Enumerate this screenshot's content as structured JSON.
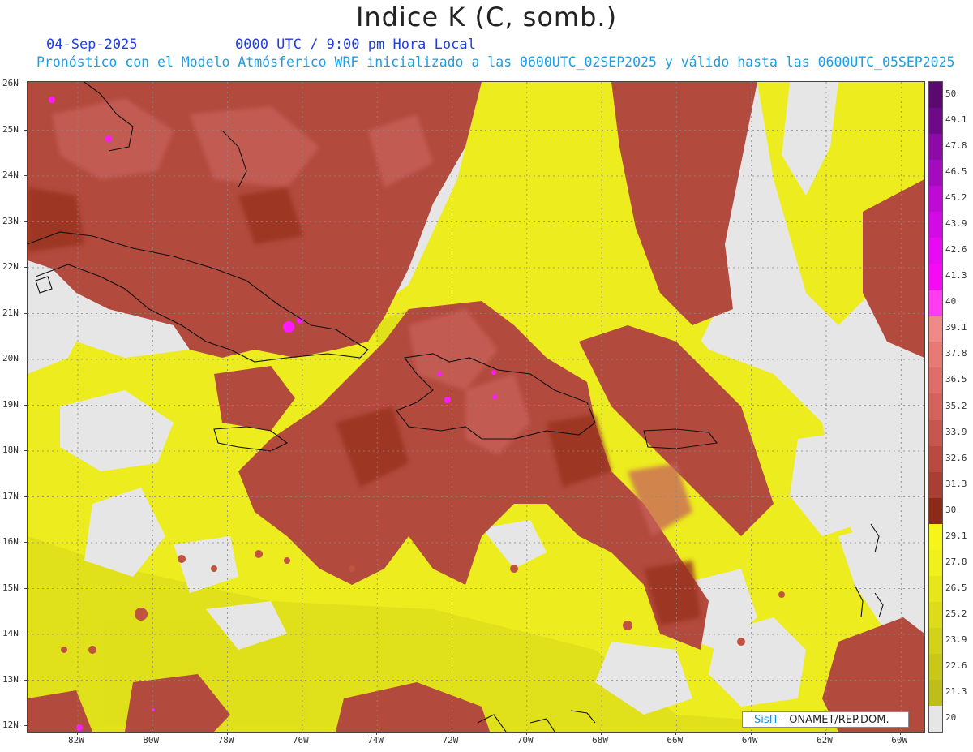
{
  "header": {
    "title": "Indice K (C, somb.)",
    "date": "04-Sep-2025",
    "time": "0000 UTC / 9:00 pm Hora Local",
    "description": "Pronóstico con el Modelo Atmósferico WRF inicializado a las 0600UTC_02SEP2025 y válido hasta las  0600UTC_05SEP2025"
  },
  "map": {
    "lat_labels": [
      "26N",
      "25N",
      "24N",
      "23N",
      "22N",
      "21N",
      "20N",
      "19N",
      "18N",
      "17N",
      "16N",
      "15N",
      "14N",
      "13N",
      "12N"
    ],
    "lon_labels": [
      "82W",
      "80W",
      "78W",
      "76W",
      "74W",
      "72W",
      "70W",
      "68W",
      "66W",
      "64W",
      "62W",
      "60W"
    ],
    "background_color": "#e6e6e6"
  },
  "colorbar": {
    "levels": [
      "50",
      "49.1",
      "47.8",
      "46.5",
      "45.2",
      "43.9",
      "42.6",
      "41.3",
      "40",
      "39.1",
      "37.8",
      "36.5",
      "35.2",
      "33.9",
      "32.6",
      "31.3",
      "30",
      "29.1",
      "27.8",
      "26.5",
      "25.2",
      "23.9",
      "22.6",
      "21.3",
      "20"
    ],
    "colors": [
      "#5a0a6e",
      "#6e0a88",
      "#8c0aa6",
      "#a40ac0",
      "#bf0ad6",
      "#d40ae6",
      "#e80af2",
      "#f50af5",
      "#ff3cf0",
      "#f08a86",
      "#e87a76",
      "#df6e6a",
      "#d4635e",
      "#c55650",
      "#b84a42",
      "#a83e34",
      "#8c2a18",
      "#f5f51a",
      "#f0f01a",
      "#e6e61a",
      "#dcdc1a",
      "#d2d21a",
      "#c8c81a",
      "#bebe1a",
      "#e6e6e6"
    ]
  },
  "credit": {
    "brand": "SisΠ",
    "org": "– ONAMET/REP.DOM."
  }
}
